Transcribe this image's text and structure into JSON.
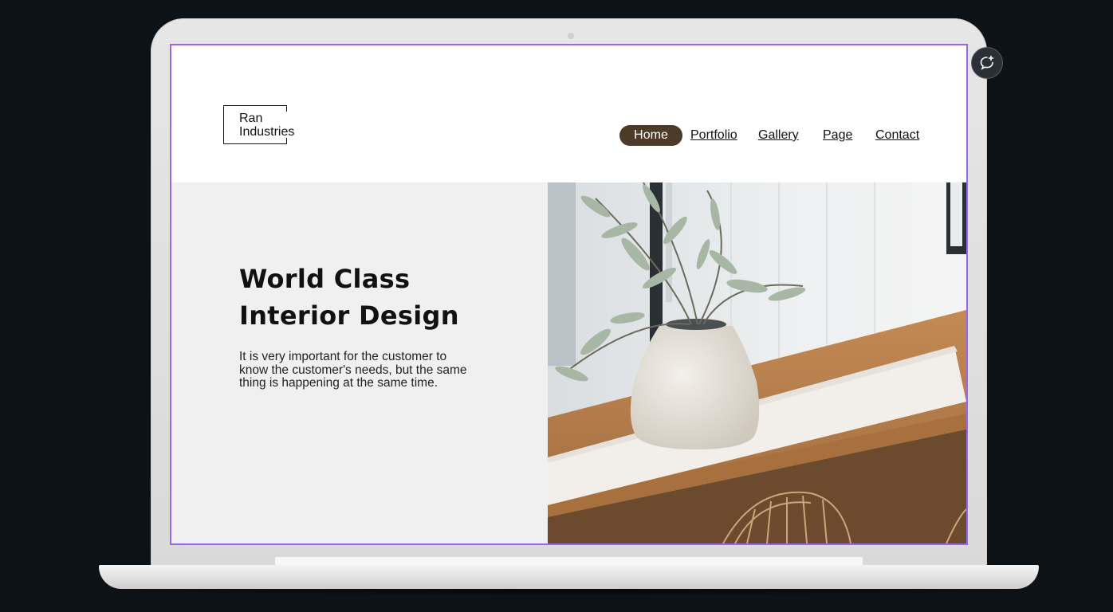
{
  "brand": {
    "line1": "Ran",
    "line2": "Industries"
  },
  "nav": {
    "items": [
      {
        "label": "Home",
        "active": true
      },
      {
        "label": "Portfolio",
        "active": false
      },
      {
        "label": "Gallery",
        "active": false
      },
      {
        "label": "Page",
        "active": false
      },
      {
        "label": "Contact",
        "active": false
      }
    ]
  },
  "hero": {
    "title_line1": "World Class",
    "title_line2": "Interior Design",
    "body": "It is very important for the customer to know the customer's needs, but the same thing is happening at the same time.",
    "image": "vase-with-eucalyptus-on-wooden-table"
  },
  "colors": {
    "accent": "#4d3b2a",
    "selection_outline": "#9a66f0",
    "hero_bg": "#f0f0f0",
    "backdrop": "#0d1217"
  },
  "widgets": {
    "chat_icon": "chat-bubble-plus-icon"
  }
}
